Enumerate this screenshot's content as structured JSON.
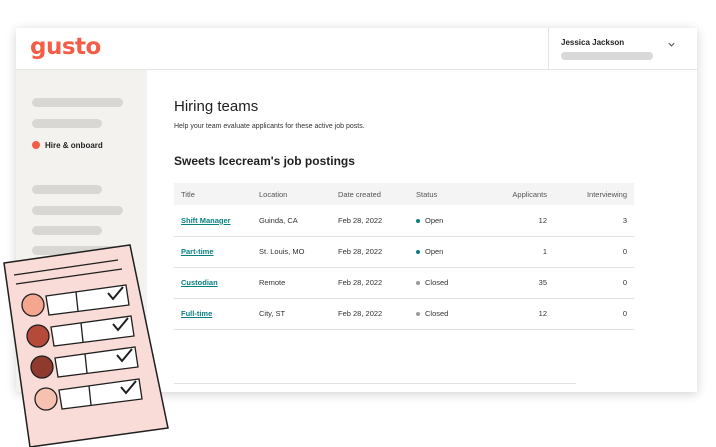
{
  "app": {
    "logo": "gusto"
  },
  "user": {
    "name": "Jessica Jackson"
  },
  "sidebar": {
    "active_item": "Hire & onboard"
  },
  "page": {
    "title": "Hiring teams",
    "subtitle": "Help your team evaluate applicants for these active job posts.",
    "section_title": "Sweets Icecream's job postings"
  },
  "table": {
    "headers": {
      "title": "Title",
      "location": "Location",
      "date_created": "Date created",
      "status": "Status",
      "applicants": "Applicants",
      "interviewing": "Interviewing"
    },
    "rows": [
      {
        "title": "Shift Manager",
        "location": "Guinda, CA",
        "date": "Feb 28, 2022",
        "status": "Open",
        "applicants": "12",
        "interviewing": "3"
      },
      {
        "title": "Part-time",
        "location": "St. Louis, MO",
        "date": "Feb 28, 2022",
        "status": "Open",
        "applicants": "1",
        "interviewing": "0"
      },
      {
        "title": "Custodian",
        "location": "Remote",
        "date": "Feb 28, 2022",
        "status": "Closed",
        "applicants": "35",
        "interviewing": "0"
      },
      {
        "title": "Full-time",
        "location": "City, ST",
        "date": "Feb 28, 2022",
        "status": "Closed",
        "applicants": "12",
        "interviewing": "0"
      }
    ]
  },
  "colors": {
    "brand": "#f45d48",
    "link": "#0a8080",
    "status_open": "#0a8080",
    "status_closed": "#9a9a9a"
  },
  "icons": {
    "user_menu": "chevron-down-icon",
    "illustration": "checklist-illustration"
  }
}
